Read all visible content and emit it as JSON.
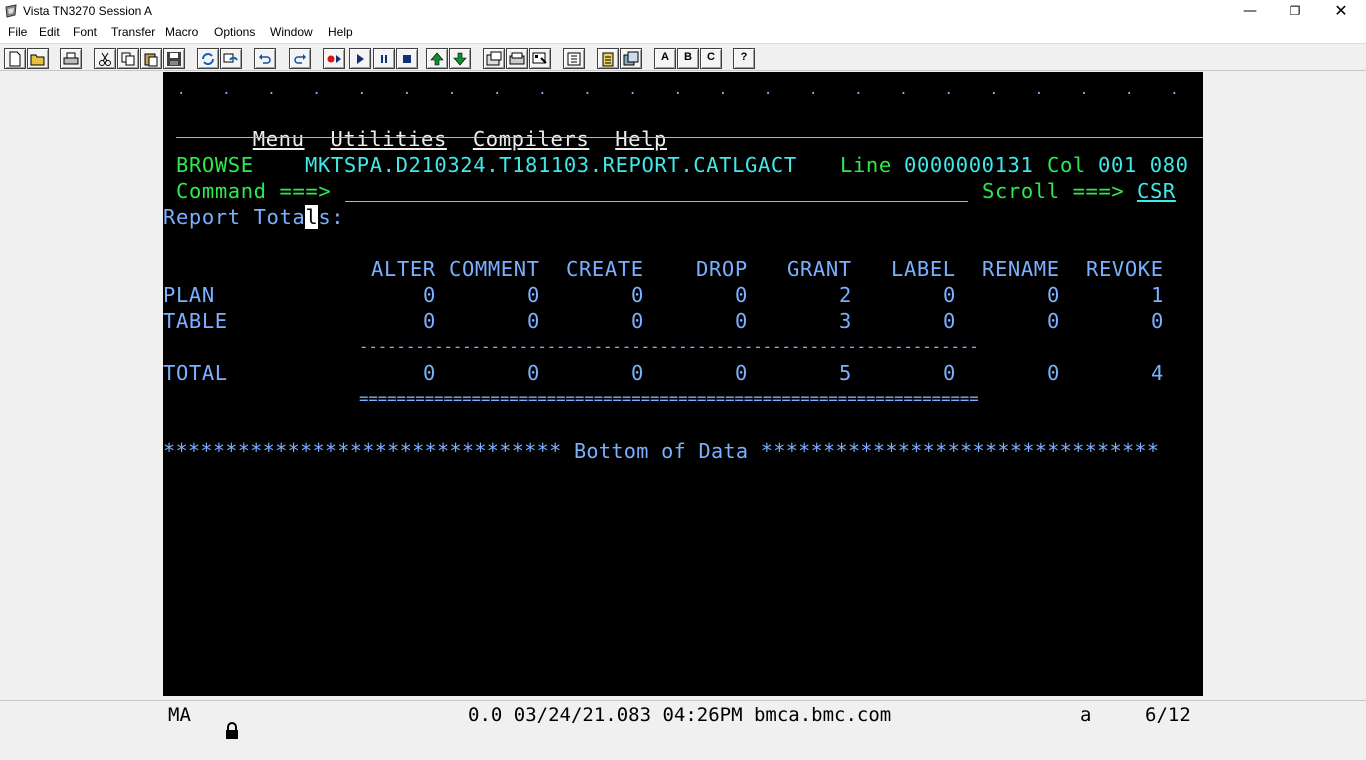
{
  "window": {
    "title": "Vista TN3270 Session A",
    "min_glyph": "—",
    "max_glyph": "❐",
    "close_glyph": "✕"
  },
  "menubar": {
    "items": [
      "File",
      "Edit",
      "Font",
      "Transfer",
      "Macro",
      "Options",
      "Window",
      "Help"
    ]
  },
  "toolbar": {
    "buttons": [
      "new-icon",
      "open-icon",
      "print-icon",
      "cut-icon",
      "copy-icon",
      "paste-icon",
      "save-icon",
      "connect-icon",
      "disconnect-icon",
      "undo-icon",
      "redo-icon",
      "record-macro-icon",
      "play-macro-icon",
      "pause-macro-icon",
      "stop-macro-icon",
      "upload-icon",
      "download-icon",
      "properties-icon",
      "keyboard-map-icon",
      "color-map-icon",
      "hotspot-icon",
      "clipboard-icon",
      "multi-copy-icon"
    ],
    "session_a": "A",
    "session_b": "B",
    "session_c": "C",
    "help": "?"
  },
  "terminal": {
    "dots": ".    .    .    .    .    .    .    .    .    .    .    .    .    .    .    .    .    .    .    .    .    .    .    .    .    .    .",
    "menu": {
      "menu": "Menu",
      "utilities": "Utilities",
      "compilers": "Compilers",
      "help": "Help"
    },
    "header": {
      "mode": "BROWSE",
      "dataset": "MKTSPA.D210324.T181103.REPORT.CATLGACT",
      "line_label": "Line",
      "line_value": "0000000131",
      "col_label": "Col",
      "col_value": "001 080",
      "command_label": "Command ===>",
      "command_value": "",
      "scroll_label": "Scroll ===>",
      "scroll_value": "CSR"
    },
    "report_title_pre": "Report Tota",
    "report_title_cursor": "l",
    "report_title_post": "s:",
    "table": {
      "headers": [
        "ALTER",
        "COMMENT",
        "CREATE",
        "DROP",
        "GRANT",
        "LABEL",
        "RENAME",
        "REVOKE"
      ],
      "rows": [
        {
          "name": "PLAN",
          "values": [
            "0",
            "0",
            "0",
            "0",
            "2",
            "0",
            "0",
            "1"
          ]
        },
        {
          "name": "TABLE",
          "values": [
            "0",
            "0",
            "0",
            "0",
            "3",
            "0",
            "0",
            "0"
          ]
        }
      ],
      "dash_line": "------------------------------------------------------------------",
      "total": {
        "name": "TOTAL",
        "values": [
          "0",
          "0",
          "0",
          "0",
          "5",
          "0",
          "0",
          "4"
        ]
      },
      "equals_line": "=================================================================="
    },
    "bottom": "******************************** Bottom of Data ********************************"
  },
  "statusbar": {
    "indicator": "MA",
    "lock": "🔒",
    "info": "0.0 03/24/21.083 04:26PM bmca.bmc.com",
    "mode": "a",
    "cursor_pos": "6/12"
  }
}
